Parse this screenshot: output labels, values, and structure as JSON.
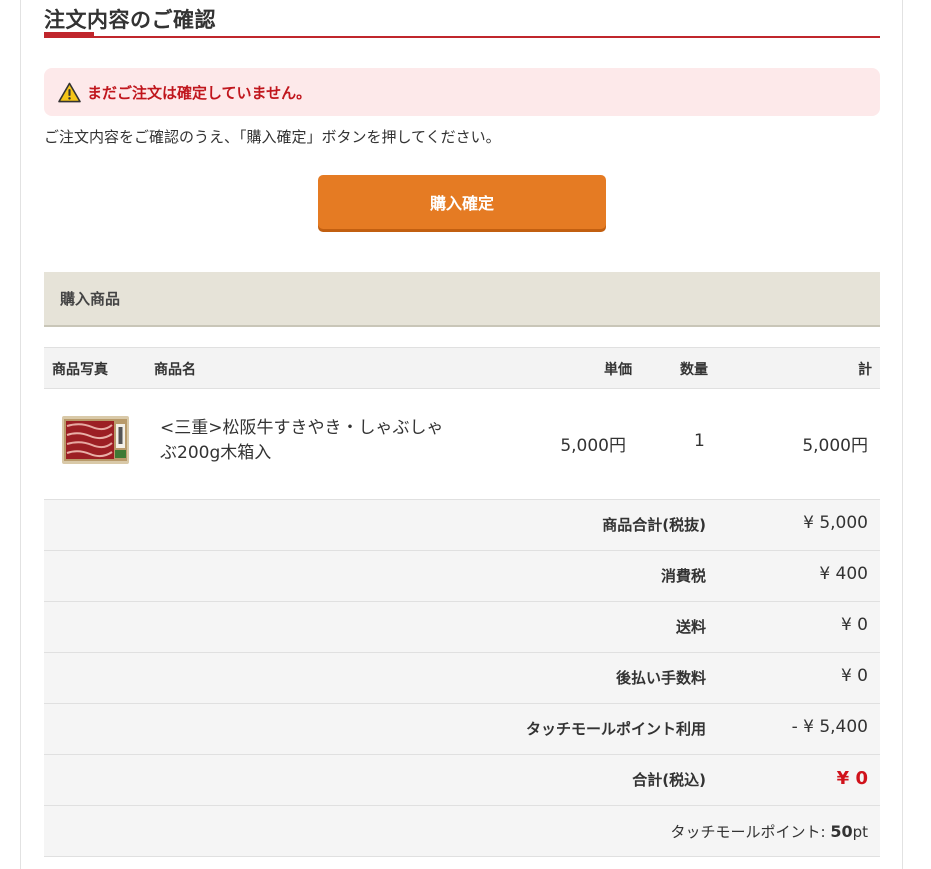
{
  "page": {
    "title": "注文内容のご確認"
  },
  "alert": {
    "icon": "warning-icon",
    "text": "まだご注文は確定していません。",
    "color": "#c0161d",
    "background": "#fde9ea"
  },
  "instructions": "ご注文内容をご確認のうえ、「購入確定」ボタンを押してください。",
  "confirm_button": {
    "label": "購入確定",
    "color": "#e57b23"
  },
  "purchased_section": {
    "title": "購入商品"
  },
  "table": {
    "headers": {
      "photo": "商品写真",
      "name": "商品名",
      "unit_price": "単価",
      "quantity": "数量",
      "total": "計"
    },
    "items": [
      {
        "name": "<三重>松阪牛すきやき・しゃぶしゃぶ200g木箱入",
        "unit_price": "5,000円",
        "quantity": "1",
        "total": "5,000円",
        "image": "wagyu-beef-box-thumbnail"
      }
    ]
  },
  "summary": {
    "subtotal": {
      "label": "商品合計(税抜)",
      "value": "¥ 5,000"
    },
    "tax": {
      "label": "消費税",
      "value": "¥ 400"
    },
    "shipping": {
      "label": "送料",
      "value": "¥ 0"
    },
    "deferred_fee": {
      "label": "後払い手数料",
      "value": "¥ 0"
    },
    "points_used": {
      "label": "タッチモールポイント利用",
      "value": "- ¥ 5,400"
    },
    "grand_total": {
      "label": "合計(税込)",
      "value": "¥ 0",
      "color": "#d0121b"
    },
    "points_earned": {
      "label": "タッチモールポイント: ",
      "value": "50",
      "unit": "pt"
    }
  }
}
